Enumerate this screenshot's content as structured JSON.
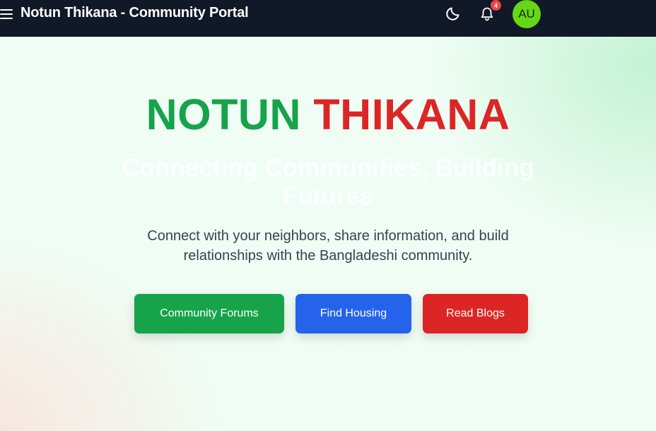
{
  "header": {
    "title": "Notun Thikana - Community Portal",
    "menu_icon": "hamburger-menu-icon",
    "theme_icon": "moon-icon",
    "notification_icon": "bell-icon",
    "notification_count": "4",
    "avatar_initials": "AU"
  },
  "hero": {
    "title_part1": "NOTUN",
    "title_part2": "THIKANA",
    "subtitle": "Connecting Communities, Building Futures",
    "description": "Connect with your neighbors, share information, and build relationships with the Bangladeshi community.",
    "buttons": {
      "forums": "Community Forums",
      "housing": "Find Housing",
      "blogs": "Read Blogs"
    }
  },
  "colors": {
    "header_bg": "#111827",
    "brand_green": "#16a34a",
    "brand_red": "#dc2626",
    "housing_blue": "#2563eb",
    "avatar_bg": "#65d717",
    "badge_red": "#ef4444"
  }
}
